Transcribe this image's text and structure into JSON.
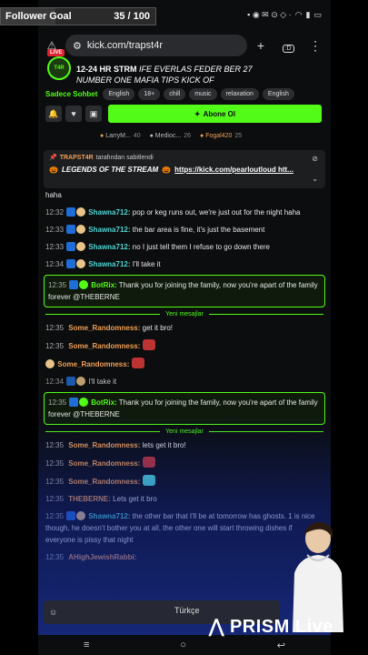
{
  "goal": {
    "label": "Follower Goal",
    "count": "35 / 100",
    "fraction": 0.35
  },
  "status": {
    "time": "",
    "battery": ""
  },
  "browser": {
    "url": "kick.com/trapst4r",
    "tab_count": ":D"
  },
  "stream": {
    "live": "LIVE",
    "title_lead": "12-24 HR STRM",
    "title_rest": "IFE EVERLAS FEDER BER 27 ",
    "title_line2": "NUMBER ONE MAFIA TIPS KICK OF",
    "category": "Sadece Sohbet",
    "tags": [
      "English",
      "18+",
      "chill",
      "music",
      "relaxation",
      "English"
    ],
    "follow_label": "Abone Ol"
  },
  "chatters": [
    {
      "name": "LarryM...",
      "count": "40"
    },
    {
      "name": "Medioc...",
      "count": "26"
    },
    {
      "name": "Fogal420",
      "count": "25"
    }
  ],
  "pinned": {
    "pinned_by": "TRAPST4R",
    "pinned_suffix": "tarafından sabitlendi",
    "text": "LEGENDS OF THE STREAM",
    "link": "https://kick.com/pearloutloud htt..."
  },
  "messages": [
    {
      "ts": "",
      "user": "",
      "text": "haha"
    },
    {
      "ts": "12:32",
      "user": "Shawna712:",
      "text": "pop or keg runs out, we're just out for the night haha"
    },
    {
      "ts": "12:33",
      "user": "Shawna712:",
      "text": "the bar area is fine, it's just the basement"
    },
    {
      "ts": "12:33",
      "user": "Shawna712:",
      "text": "no I just tell them I refuse to go down there"
    },
    {
      "ts": "12:34",
      "user": "Shawna712:",
      "text": "I'll take it"
    },
    {
      "ts": "12:35",
      "user": "BotRix:",
      "text": "Thank you for joining the family, now you're apart of the family forever @THEBERNE"
    },
    {
      "ts": "12:35",
      "user": "Some_Randomness:",
      "text": "get it bro!"
    },
    {
      "ts": "12:35",
      "user": "Some_Randomness:",
      "text": ""
    },
    {
      "ts": "12:35",
      "user": "Some_Randomness:",
      "text": ""
    },
    {
      "ts": "12:34",
      "user": "",
      "text": "I'll take it"
    },
    {
      "ts": "12:35",
      "user": "BotRix:",
      "text": "Thank you for joining the family, now you're apart of the family forever @THEBERNE"
    },
    {
      "ts": "12:35",
      "user": "Some_Randomness:",
      "text": "lets get it bro!"
    },
    {
      "ts": "12:35",
      "user": "Some_Randomness:",
      "text": ""
    },
    {
      "ts": "12:35",
      "user": "Some_Randomness:",
      "text": ""
    },
    {
      "ts": "12:35",
      "user": "THEBERNE:",
      "text": "Lets get it bro"
    },
    {
      "ts": "12:35",
      "user": "Shawna712:",
      "text": "the other bar that I'll be at tomorrow has ghosts. 1 is nice though, he doesn't bother you at all, the other one will start throwing dishes if everyone is pissy that night"
    },
    {
      "ts": "12:35",
      "user": "AHighJewishRabbi:",
      "text": ""
    }
  ],
  "new_messages_label": "Yeni mesajlar",
  "keyboard": {
    "lang": "Türkçe"
  },
  "overlay_brand": "PRISM Live",
  "colors": {
    "kick_green": "#53fc18",
    "teal": "#4ed6d3",
    "orange": "#f2a054"
  }
}
